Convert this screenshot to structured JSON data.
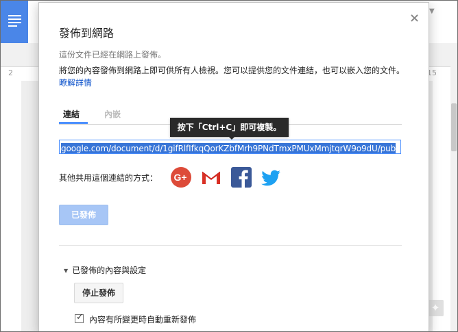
{
  "background": {
    "ruler_left": "2",
    "ruler_right": "15"
  },
  "dialog": {
    "title": "發佈到網路",
    "status": "這份文件已經在網路上發佈。",
    "description": "將您的內容發佈到網路上即可供所有人檢視。您可以提供您的文件連結，也可以嵌入您的文件。",
    "learn_more": "瞭解詳情",
    "close_glyph": "×",
    "tabs": [
      {
        "label": "連結",
        "active": true
      },
      {
        "label": "內嵌",
        "active": false
      }
    ],
    "tooltip": "按下「Ctrl+C」即可複製。",
    "url": "google.com/document/d/1gifRlfIfkqQorKZbfMrh9PNdTmxPMUxMmjtqrW9o9dU/pub",
    "share_label": "其他共用這個連結的方式：",
    "share_icons": [
      "google-plus-icon",
      "gmail-icon",
      "facebook-icon",
      "twitter-icon"
    ],
    "published_button": "已發佈",
    "section_toggle": "已發佈的內容與設定",
    "stop_button": "停止發佈",
    "auto_republish": {
      "label": "內容有所變更時自動重新發佈",
      "checked": true
    }
  },
  "colors": {
    "accent": "#4d90fe",
    "link": "#1155cc",
    "selection": "#3875d7",
    "published_button": "#a7c6f6",
    "google_plus": "#dd4b39",
    "facebook": "#3b5998",
    "twitter": "#1da1f2",
    "docs_blue": "#4a86e8"
  }
}
